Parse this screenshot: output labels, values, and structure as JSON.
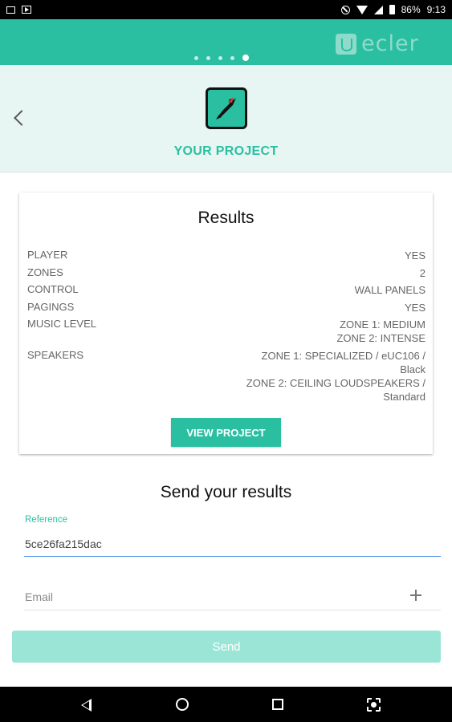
{
  "status_bar": {
    "battery": "86%",
    "time": "9:13"
  },
  "header": {
    "brand": "ecler",
    "steps_total": 5,
    "steps_active": 5
  },
  "project": {
    "title": "YOUR PROJECT",
    "icon": "flying-superhero-icon"
  },
  "results": {
    "title": "Results",
    "rows": [
      {
        "label": "PLAYER",
        "value": "YES"
      },
      {
        "label": "ZONES",
        "value": "2"
      },
      {
        "label": "CONTROL",
        "value": "WALL PANELS"
      },
      {
        "label": "PAGINGS",
        "value": "YES"
      },
      {
        "label": "MUSIC LEVEL",
        "value": "ZONE 1: MEDIUM\nZONE 2: INTENSE"
      },
      {
        "label": "SPEAKERS",
        "value": "ZONE 1: SPECIALIZED / eUC106 /\nBlack\nZONE 2: CEILING LOUDSPEAKERS /\nStandard"
      }
    ],
    "view_project_label": "VIEW PROJECT"
  },
  "send": {
    "title": "Send your results",
    "reference_label": "Reference",
    "reference_value": "5ce26fa215dac",
    "email_placeholder": "Email",
    "send_label": "Send"
  },
  "colors": {
    "accent": "#2bbfa2",
    "accent_light": "#9be5d6",
    "banner_bg": "#e8f6f3"
  }
}
